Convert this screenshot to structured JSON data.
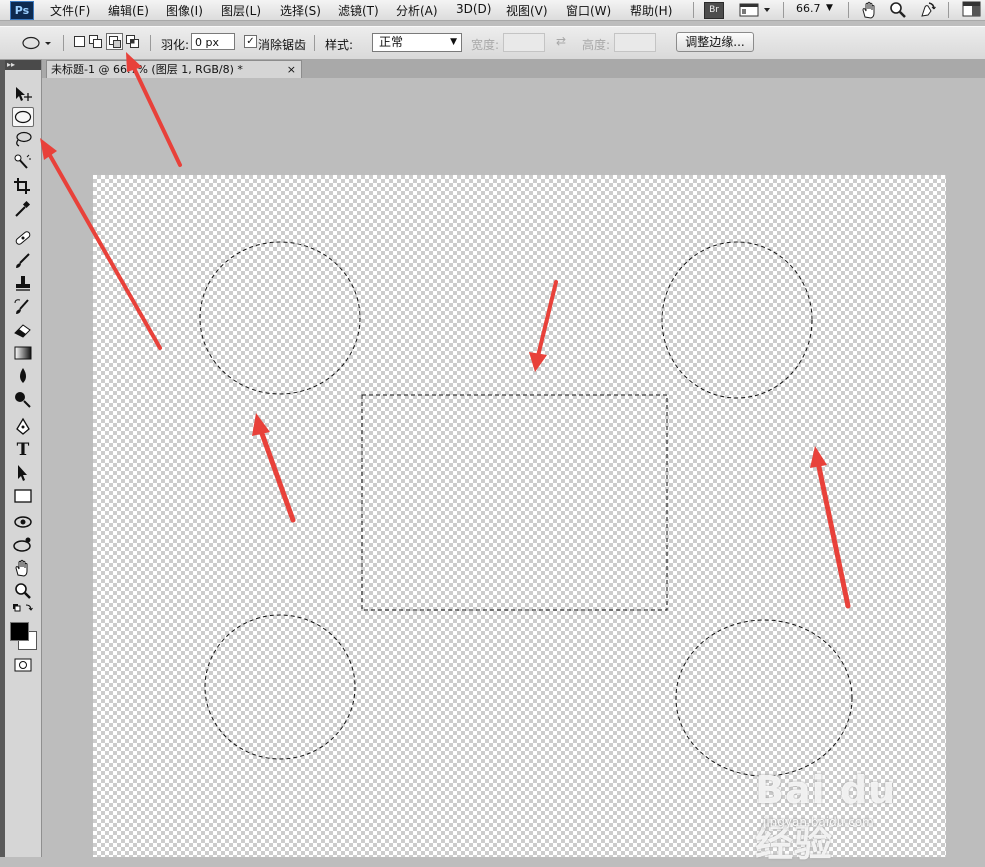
{
  "app": {
    "logo": "Ps"
  },
  "menu": {
    "items": [
      "文件(F)",
      "编辑(E)",
      "图像(I)",
      "图层(L)",
      "选择(S)",
      "滤镜(T)",
      "分析(A)",
      "3D(D)",
      "视图(V)",
      "窗口(W)",
      "帮助(H)"
    ],
    "bridge_label": "Br",
    "zoom": "66.7"
  },
  "options": {
    "feather_label": "羽化:",
    "feather_value": "0 px",
    "antialias_label": "消除锯齿",
    "antialias_checked": "✓",
    "style_label": "样式:",
    "style_value": "正常",
    "width_label": "宽度:",
    "height_label": "高度:",
    "refine_edge_label": "调整边缘..."
  },
  "document": {
    "tab_title": "未标题-1 @ 66.7% (图层 1, RGB/8) *",
    "close_glyph": "×"
  },
  "colors": {
    "arrow": "#e8413a",
    "foreground": "#000000",
    "background": "#ffffff"
  },
  "watermark": {
    "text": "Bai du 经验",
    "sub": "jingyan.baidu.com"
  }
}
